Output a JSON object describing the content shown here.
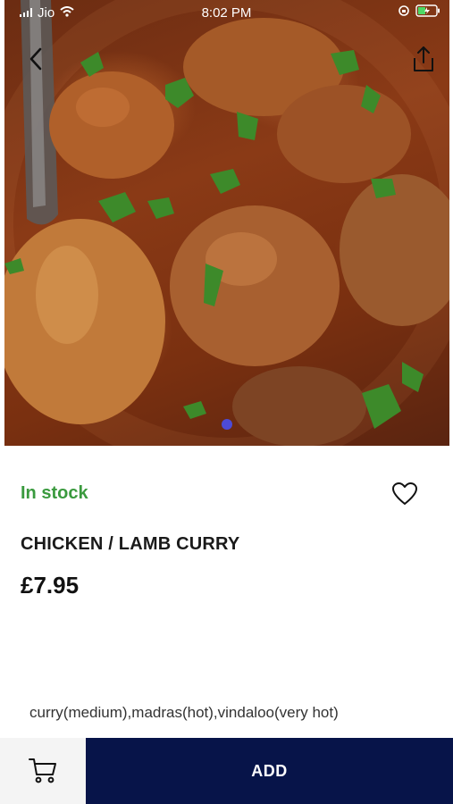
{
  "status_bar": {
    "carrier": "Jio",
    "time": "8:02 PM"
  },
  "hero": {
    "image_description_icon": "food-photo",
    "pager": {
      "current": 1
    }
  },
  "product": {
    "stock_status": "In stock",
    "stock_color": "#3a9a3e",
    "title": "CHICKEN / LAMB CURRY",
    "price": "£7.95",
    "options_text": "curry(medium),madras(hot),vindaloo(very hot)"
  },
  "bottom_bar": {
    "add_label": "ADD",
    "add_color": "#071449"
  },
  "icons": {
    "back": "chevron-left-icon",
    "share": "share-icon",
    "favorite": "heart-outline-icon",
    "cart": "cart-icon"
  }
}
